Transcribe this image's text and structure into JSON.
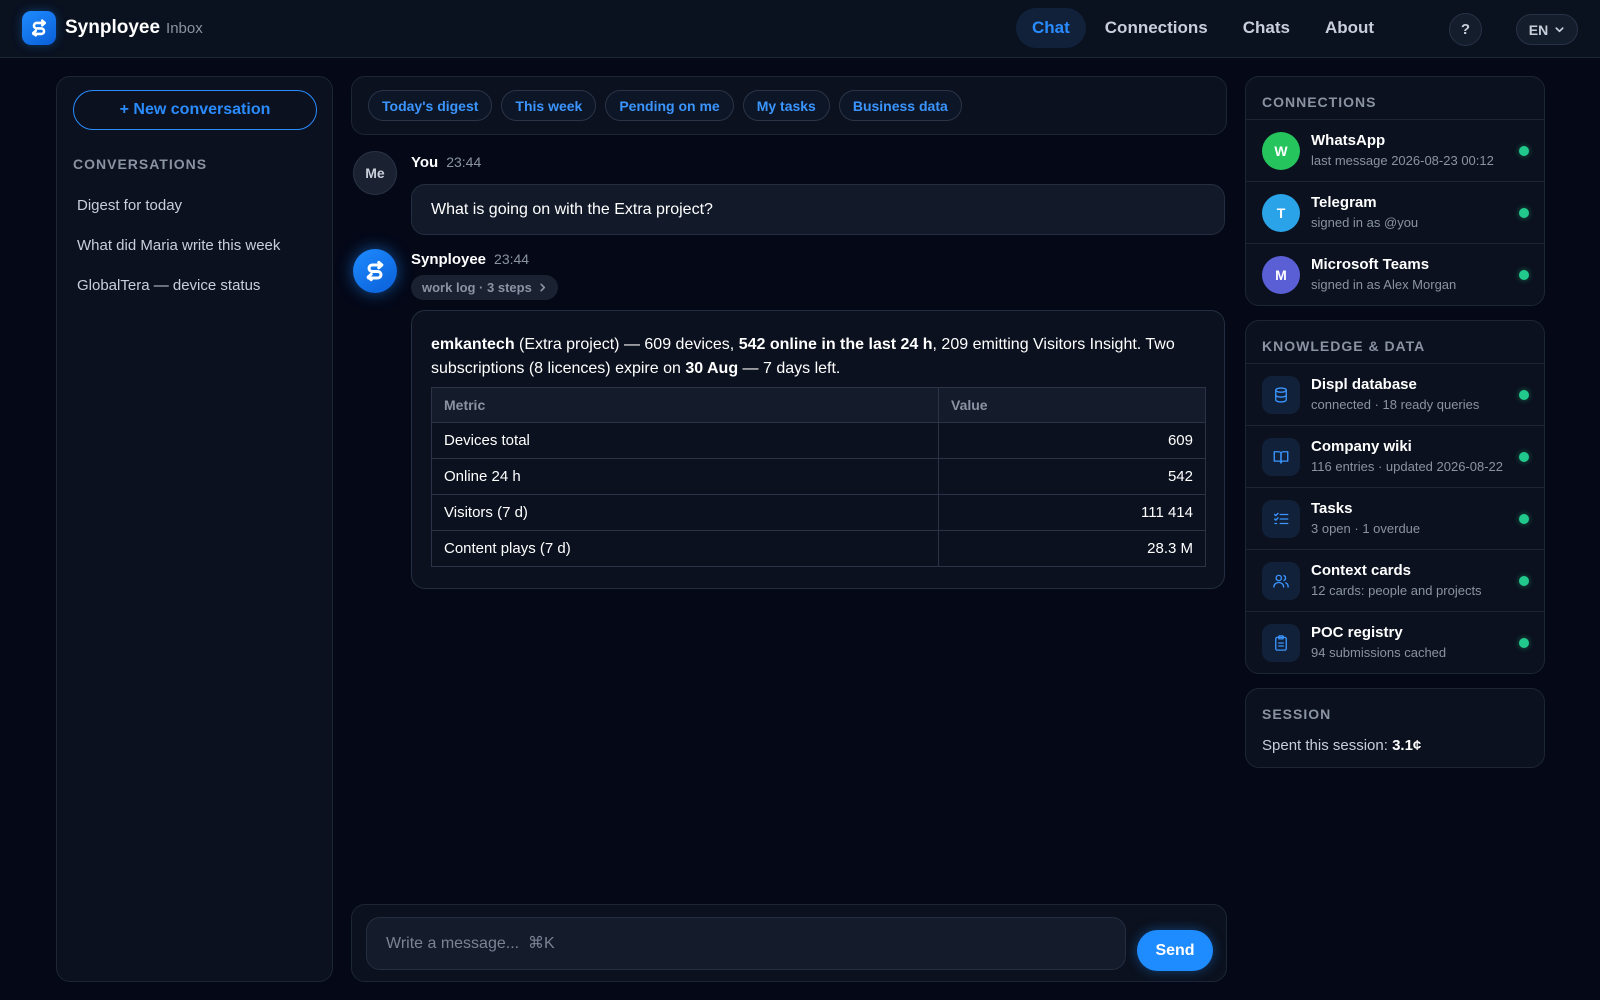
{
  "header": {
    "brand": "Synployee",
    "brand_sub": "Inbox",
    "nav": [
      {
        "label": "Chat",
        "active": true
      },
      {
        "label": "Connections",
        "active": false
      },
      {
        "label": "Chats",
        "active": false
      },
      {
        "label": "About",
        "active": false
      }
    ],
    "help_label": "?",
    "language": "EN"
  },
  "sidebar": {
    "new_conversation": "+ New conversation",
    "section_title": "Conversations",
    "items": [
      "Digest for today",
      "What did Maria write this week",
      "GlobalTera — device status"
    ]
  },
  "chips": [
    "Today's digest",
    "This week",
    "Pending on me",
    "My tasks",
    "Business data"
  ],
  "messages": {
    "user": {
      "avatar": "Me",
      "author": "You",
      "time": "23:44",
      "text": "What is going on with the Extra project?"
    },
    "bot": {
      "author": "Synployee",
      "time": "23:44",
      "worklog": "work log · 3 steps",
      "text_parts": {
        "p1": "emkantech",
        "p2": " (Extra project) — 609 devices, ",
        "p3": "542 online in the last 24 h",
        "p4": ", 209 emitting Visitors Insight. Two subscriptions (8 licences) expire on ",
        "p5": "30 Aug",
        "p6": " — 7 days left."
      },
      "table": {
        "headers": [
          "Metric",
          "Value"
        ],
        "rows": [
          [
            "Devices total",
            "609"
          ],
          [
            "Online 24 h",
            "542"
          ],
          [
            "Visitors (7 d)",
            "111 414"
          ],
          [
            "Content plays (7 d)",
            "28.3 M"
          ]
        ]
      }
    }
  },
  "composer": {
    "placeholder": "Write a message...  ⌘K",
    "send": "Send"
  },
  "right": {
    "connections_title": "Connections",
    "connections": [
      {
        "initial": "W",
        "title": "WhatsApp",
        "sub": "last message 2026-08-23 00:12",
        "color": "#25c45c",
        "status": "online"
      },
      {
        "initial": "T",
        "title": "Telegram",
        "sub": "signed in as @you",
        "color": "#2aa3e8",
        "status": "online"
      },
      {
        "initial": "M",
        "title": "Microsoft Teams",
        "sub": "signed in as Alex Morgan",
        "color": "#5b5fd6",
        "status": "online"
      }
    ],
    "knowledge_title": "Knowledge & data",
    "knowledge": [
      {
        "icon": "database-icon",
        "title": "Displ database",
        "sub": "connected · 18 ready queries",
        "status": "online"
      },
      {
        "icon": "book-icon",
        "title": "Company wiki",
        "sub": "116 entries · updated 2026-08-22",
        "status": "online"
      },
      {
        "icon": "checklist-icon",
        "title": "Tasks",
        "sub": "3 open · 1 overdue",
        "status": "online"
      },
      {
        "icon": "people-icon",
        "title": "Context cards",
        "sub": "12 cards: people and projects",
        "status": "online"
      },
      {
        "icon": "clipboard-icon",
        "title": "POC registry",
        "sub": "94 submissions cached",
        "status": "online"
      }
    ],
    "session_title": "Session",
    "session_label": "Spent this session: ",
    "session_value": "3.1¢"
  },
  "colors": {
    "accent": "#1e8bff",
    "status_online": "#22c98c",
    "background": "#040817"
  }
}
